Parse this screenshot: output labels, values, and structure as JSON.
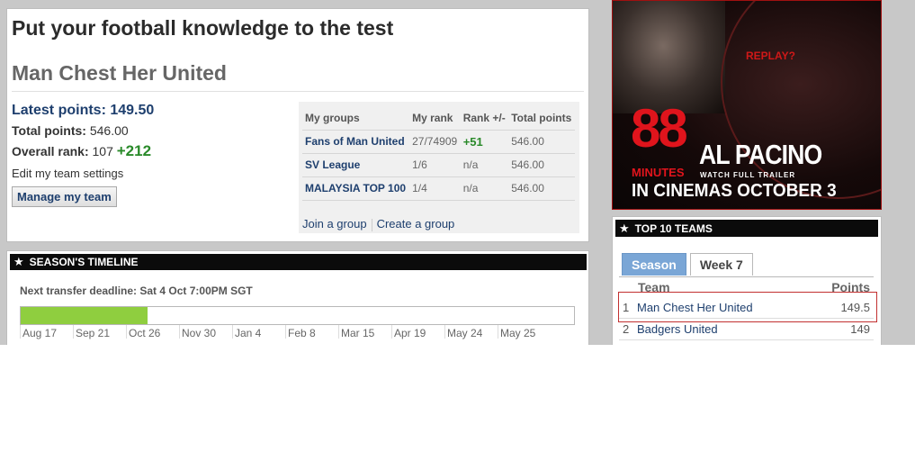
{
  "main": {
    "title": "Put your football knowledge to the test",
    "team_name": "Man Chest Her United",
    "latest_points_label": "Latest points:",
    "latest_points_value": "149.50",
    "total_points_label": "Total points:",
    "total_points_value": "546.00",
    "overall_rank_label": "Overall rank:",
    "overall_rank_value": "107",
    "overall_rank_change": "+212",
    "edit_link": "Edit my team settings",
    "manage_button": "Manage my team"
  },
  "groups": {
    "headers": [
      "My groups",
      "My rank",
      "Rank +/-",
      "Total points"
    ],
    "rows": [
      {
        "name": "Fans of Man United",
        "rank": "27/74909",
        "change": "+51",
        "points": "546.00"
      },
      {
        "name": "SV League",
        "rank": "1/6",
        "change": "n/a",
        "points": "546.00"
      },
      {
        "name": "MALAYSIA TOP 100",
        "rank": "1/4",
        "change": "n/a",
        "points": "546.00"
      }
    ],
    "join_link": "Join a group",
    "create_link": "Create a group"
  },
  "timeline": {
    "title": "SEASON'S TIMELINE",
    "deadline": "Next transfer deadline: Sat 4 Oct 7:00PM SGT",
    "progress": 0.23,
    "months": [
      "Aug 17",
      "Sep 21",
      "Oct 26",
      "Nov 30",
      "Jan 4",
      "Feb 8",
      "Mar 15",
      "Apr 19",
      "May 24",
      "May 25"
    ]
  },
  "ad": {
    "replay": "REPLAY?",
    "number": "88",
    "minutes": "MINUTES",
    "name": "AL PACINO",
    "trailer": "WATCH FULL TRAILER",
    "cinemas": "IN CINEMAS OCTOBER 3"
  },
  "top10": {
    "title": "TOP 10 TEAMS",
    "tabs": [
      "Season",
      "Week 7"
    ],
    "col_team": "Team",
    "col_points": "Points",
    "rows": [
      {
        "rank": "1",
        "name": "Man Chest Her United",
        "points": "149.5"
      },
      {
        "rank": "2",
        "name": "Badgers United",
        "points": "149"
      }
    ]
  },
  "colors": {
    "link": "#1e3f6e",
    "positive": "#2a8a2a",
    "progress": "#8fce3f",
    "tab_active": "#7aa6d6",
    "highlight": "#c23030"
  }
}
